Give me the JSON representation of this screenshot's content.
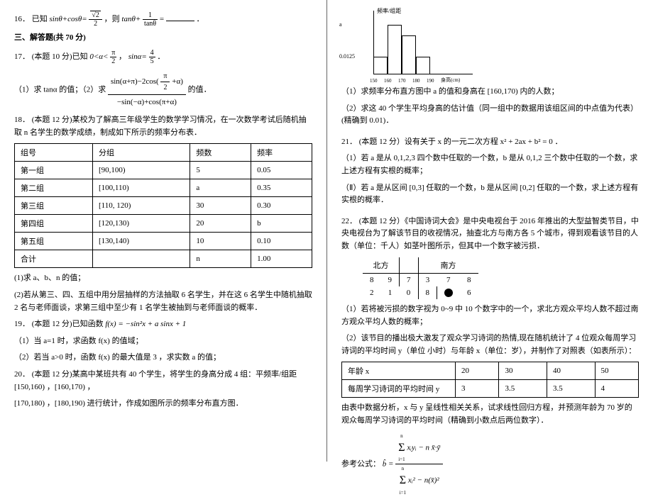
{
  "q16": {
    "num": "16．",
    "pre": "已知",
    "expr1": "sinθ+cosθ=",
    "sqrt2": "√2",
    "over2": "2",
    "mid": "，则",
    "expr2": "tanθ+",
    "frac_num": "1",
    "frac_den": "tanθ",
    "equals": " =",
    "end": "．"
  },
  "section3": "三、解答题(共 70 分)",
  "q17": {
    "num": "17．",
    "text1": "(本题 10 分)已知",
    "range": "0<α<",
    "pi2_n": "π",
    "pi2_d": "2",
    "comma": "，",
    "sina": "sinα=",
    "four5_n": "4",
    "four5_d": "5",
    "period": "．",
    "part1": "（1）求 tanα 的值；（2）求",
    "bigfrac_num": "sin(α+π)−2cos(",
    "bigfrac_num2_n": "π",
    "bigfrac_num2_d": "2",
    "bigfrac_num3": "+α)",
    "bigfrac_den": "−sin(−α)+cos(π+α)",
    "part2_end": "的值．"
  },
  "q18": {
    "num": "18．",
    "text": "(本题 12 分)某校为了解高三年级学生的数学学习情况，在一次数学考试后随机抽取 n 名学生的数学成绩，制成如下所示的频率分布表．",
    "headers": [
      "组号",
      "分组",
      "频数",
      "频率"
    ],
    "rows": [
      [
        "第一组",
        "[90,100)",
        "5",
        "0.05"
      ],
      [
        "第二组",
        "[100,110)",
        "a",
        "0.35"
      ],
      [
        "第三组",
        "[110, 120)",
        "30",
        "0.30"
      ],
      [
        "第四组",
        "[120,130)",
        "20",
        "b"
      ],
      [
        "第五组",
        "[130,140)",
        "10",
        "0.10"
      ],
      [
        "合计",
        "",
        "n",
        "1.00"
      ]
    ],
    "sub1": "(1)求 a、b、n 的值；",
    "sub2": "(2)若从第三、四、五组中用分层抽样的方法抽取 6 名学生，并在这 6 名学生中随机抽取 2 名与老师面谈，求第三组中至少有 1 名学生被抽到与老师面谈的概率．"
  },
  "q19": {
    "num": "19．",
    "text": "(本题 12 分)已知函数 ",
    "fx": "f(x) = −sin²x + a sinx + 1",
    "sub1": "（1）当 a=1 时，求函数 f(x) 的值域；",
    "sub2": "（2）若当 a>0 时，函数 f(x) 的最大值是 3 ，求实数 a 的值；"
  },
  "q20": {
    "num": "20．",
    "text1": "(本题 12 分)某高中某班共有 40 个学生，将学生的身高分成 4 组：平频率/组距 [150,160) ，[160,170) ，",
    "text2": "[170,180) ，[180,190) 进行统计，作成如图所示的频率分布直方图．"
  },
  "histogram": {
    "ylabel1": "a",
    "ylabel2": "0.0125",
    "xlabels": [
      "150",
      "160",
      "170",
      "180",
      "190"
    ],
    "xtitle": "身高(cm)",
    "ytitle": "频率/组距"
  },
  "q20r": {
    "sub1": "（1）求频率分布直方图中 a 的值和身高在 [160,170) 内的人数；",
    "sub2": "（2）求这 40 个学生平均身高的估计值（同一组中的数据用该组区间的中点值为代表）(精确到 0.01)．"
  },
  "q21": {
    "num": "21．",
    "text": "(本题 12 分）设有关于 x 的一元二次方程 x² + 2ax + b² = 0 ．",
    "sub1": "（1）若 a 是从 0,1,2,3 四个数中任取的一个数，b 是从 0,1,2 三个数中任取的一个数，求上述方程有实根的概率；",
    "sub2": "（Ⅱ）若 a 是从区间 [0,3] 任取的一个数，b 是从区间 [0,2] 任取的一个数，求上述方程有实根的概率．"
  },
  "q22": {
    "num": "22．",
    "text": "(本题 12 分）《中国诗词大会》是中央电视台于 2016 年推出的大型益智类节目，中央电视台为了解该节目的收视情况，抽查北方与南方各 5 个城市，得到观看该节目的人数（单位：千人）如茎叶图所示，但其中一个数字被污损．",
    "north": "北方",
    "south": "南方",
    "stem_rows": [
      [
        "8",
        "9",
        "7",
        "3",
        "7",
        "8"
      ],
      [
        "2",
        "1",
        "0",
        "8",
        "●",
        "6"
      ]
    ],
    "sub1": "（1）若将被污损的数字视为 0~9 中 10 个数字中的一个，求北方观众平均人数不超过南方观众平均人数的概率；",
    "sub2": "（2）该节目的播出极大激发了观众学习诗词的热情,现在随机统计了 4 位观众每周学习诗词的平均时间 y（单位 小时）与年龄 x（单位：岁），并制作了对照表（如表所示）：",
    "table_h1": "年龄 x",
    "table_h2": "每周学习诗词的平均时间 y",
    "table_r1": [
      "20",
      "30",
      "40",
      "50"
    ],
    "table_r2": [
      "3",
      "3.5",
      "3.5",
      "4"
    ],
    "sub3": "由表中数据分析，x 与 y 呈线性相关关系，试求线性回归方程，并预测年龄为 70 岁的观众每周学习诗词的平均时间（精确到小数点后两位数字）．",
    "formula_label": "参考公式：",
    "bhat": "b̂ =",
    "sum_top_n": "n",
    "sum_top_i": "i=1",
    "sum_expr_num": "xᵢyᵢ − n x̄·ȳ",
    "sum_expr_den": "xᵢ² − n(x̄)²"
  }
}
